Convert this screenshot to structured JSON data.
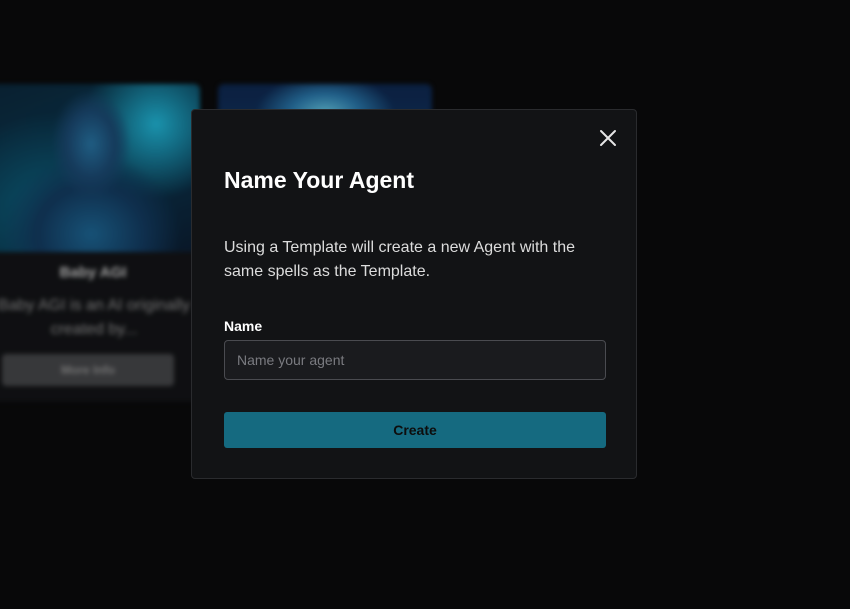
{
  "background_cards": [
    {
      "title": "Baby AGI",
      "description": "Baby AGI is an AI originally created by...",
      "button_label": "More Info"
    },
    {
      "title": "",
      "description": "",
      "button_label": ""
    }
  ],
  "modal": {
    "close_icon": "close-icon",
    "title": "Name Your Agent",
    "description": "Using a Template will create a new Agent with the same spells as the Template.",
    "name_label": "Name",
    "name_placeholder": "Name your agent",
    "name_value": "",
    "create_label": "Create"
  },
  "colors": {
    "background": "#0b0b0c",
    "modal_background": "#121315",
    "accent": "#156a80"
  }
}
